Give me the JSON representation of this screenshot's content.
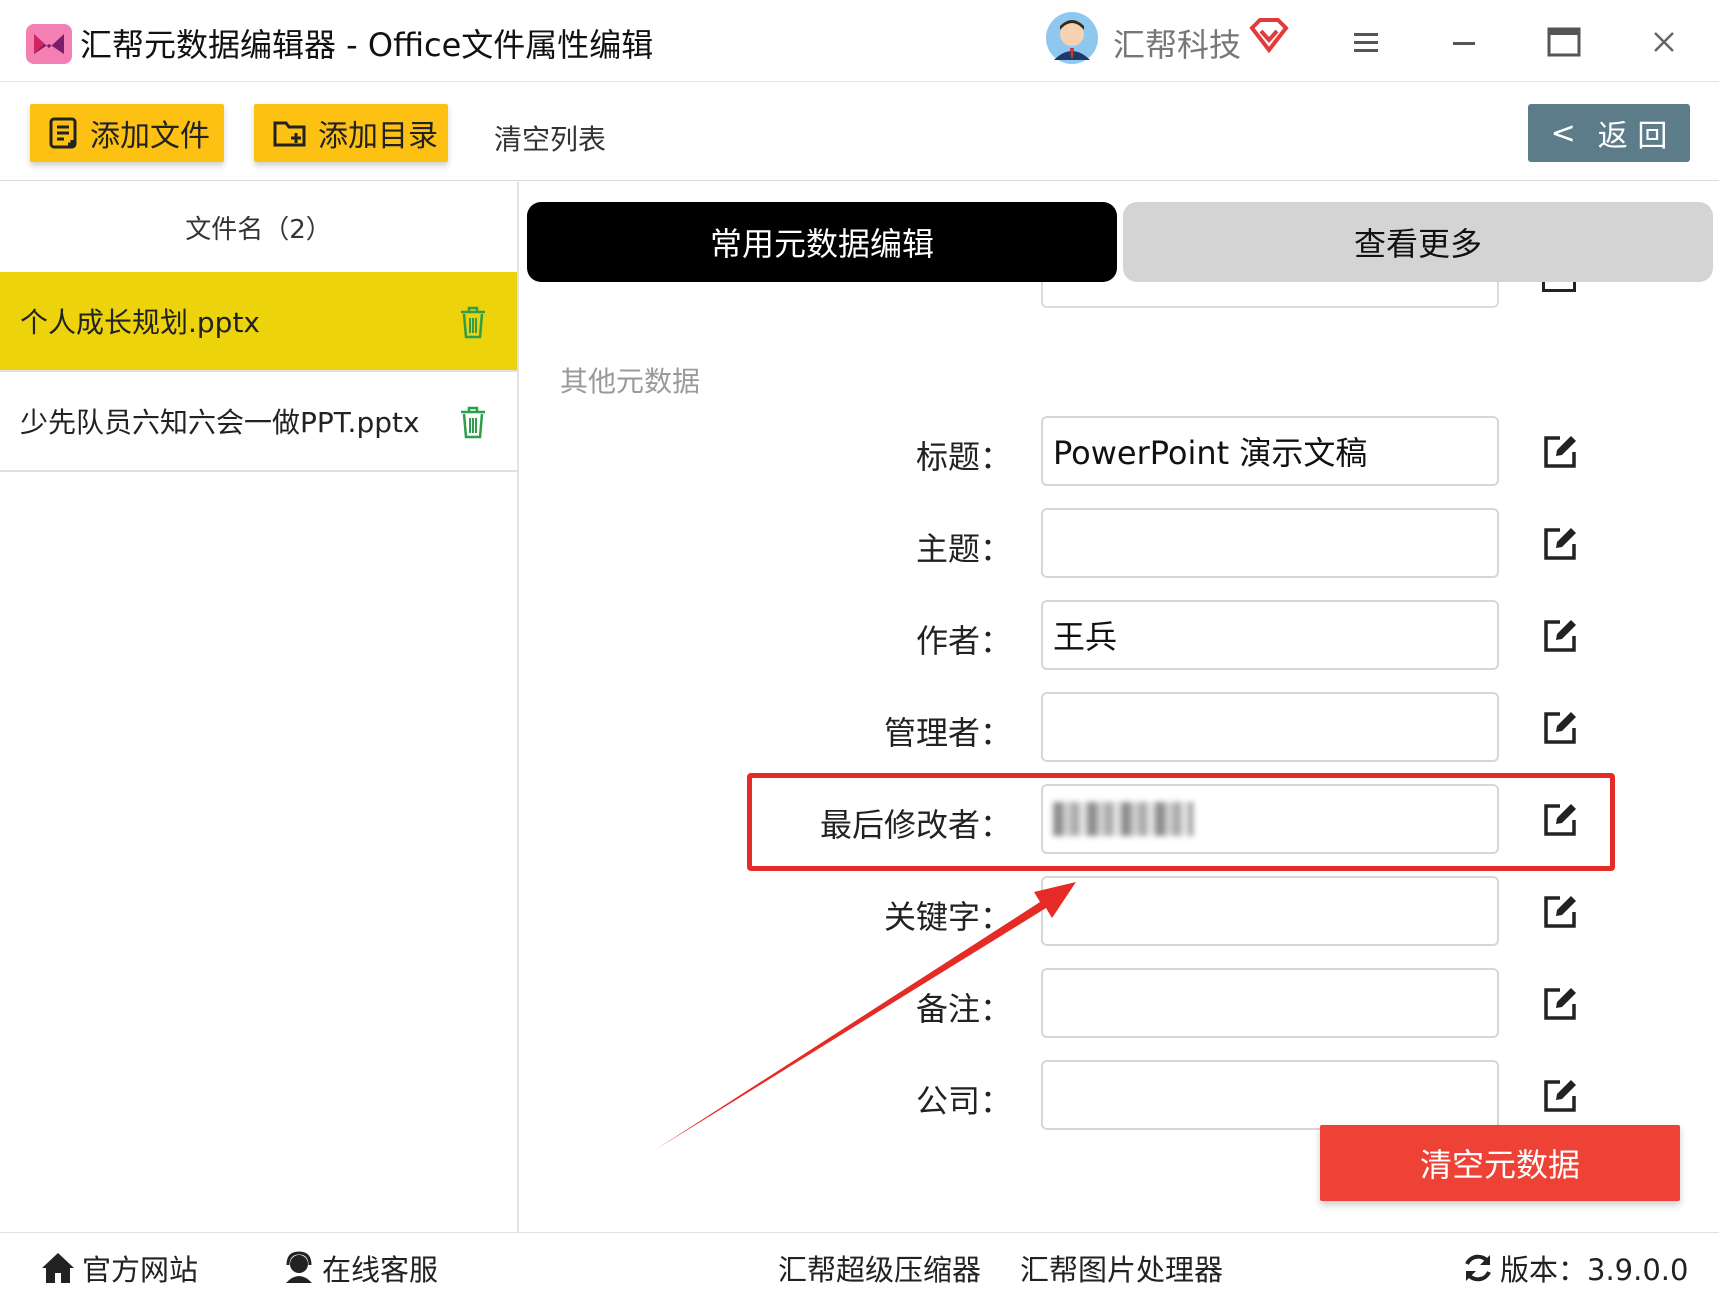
{
  "titlebar": {
    "app_title": "汇帮元数据编辑器 - Office文件属性编辑",
    "company": "汇帮科技"
  },
  "toolbar": {
    "add_file": "添加文件",
    "add_folder": "添加目录",
    "clear_list": "清空列表",
    "back": "返 回"
  },
  "file_list": {
    "header": "文件名（2）",
    "items": [
      {
        "name": "个人成长规划.pptx",
        "selected": true
      },
      {
        "name": "少先队员六知六会一做PPT.pptx",
        "selected": false
      }
    ]
  },
  "tabs": {
    "common": "常用元数据编辑",
    "more": "查看更多"
  },
  "section": {
    "other_label": "其他元数据"
  },
  "fields": [
    {
      "label": "标题：",
      "value": "PowerPoint 演示文稿"
    },
    {
      "label": "主题：",
      "value": ""
    },
    {
      "label": "作者：",
      "value": "王兵"
    },
    {
      "label": "管理者：",
      "value": ""
    },
    {
      "label": "最后修改者：",
      "value": ""
    },
    {
      "label": "关键字：",
      "value": ""
    },
    {
      "label": "备注：",
      "value": ""
    },
    {
      "label": "公司：",
      "value": ""
    }
  ],
  "actions": {
    "clear_metadata": "清空元数据"
  },
  "footer": {
    "website": "官方网站",
    "support": "在线客服",
    "compressor": "汇帮超级压缩器",
    "image_tool": "汇帮图片处理器",
    "version": "版本：3.9.0.0"
  },
  "colors": {
    "toolbar_button": "#fdc114",
    "selected_row": "#ecd30c",
    "back_button": "#5d7c8a",
    "clear_button": "#ee4236",
    "highlight": "#e52b26"
  }
}
